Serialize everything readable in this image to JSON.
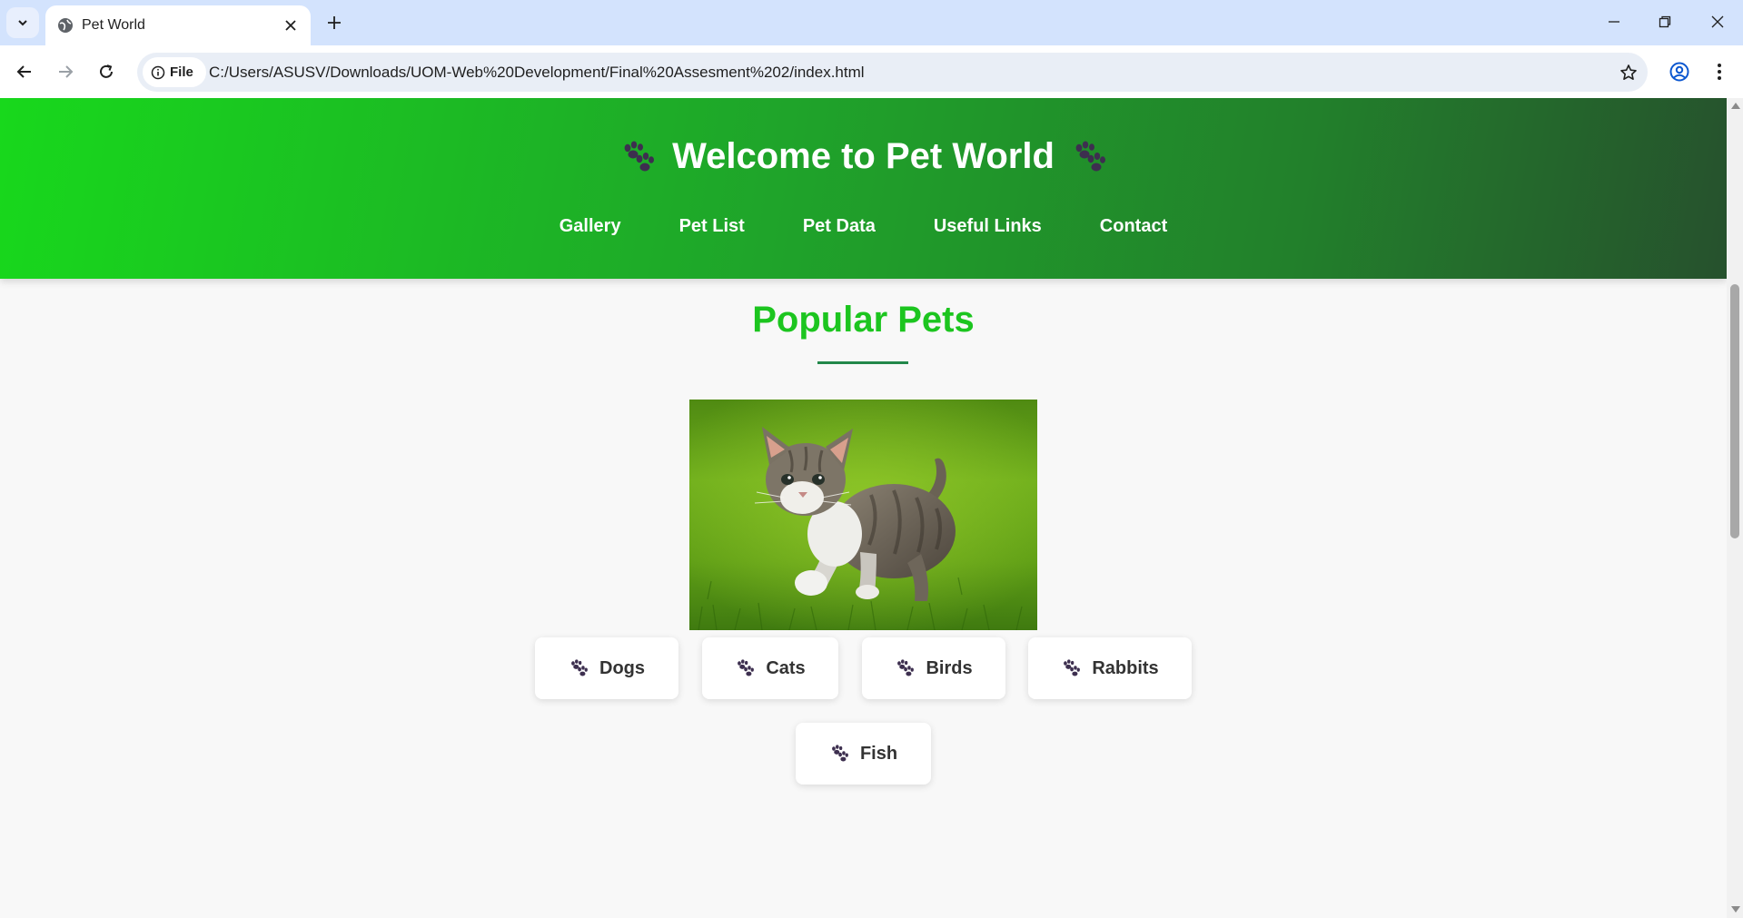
{
  "browser": {
    "tab_title": "Pet World",
    "site_chip_label": "File",
    "url": "C:/Users/ASUSV/Downloads/UOM-Web%20Development/Final%20Assesment%202/index.html"
  },
  "header": {
    "title": "Welcome to Pet World",
    "nav": [
      "Gallery",
      "Pet List",
      "Pet Data",
      "Useful Links",
      "Contact"
    ]
  },
  "section": {
    "title": "Popular Pets"
  },
  "pets": [
    "Dogs",
    "Cats",
    "Birds",
    "Rabbits",
    "Fish"
  ],
  "colors": {
    "header_gradient_start": "#18d81c",
    "header_gradient_end": "#26512d",
    "section_title": "#1cc51f",
    "underline": "#22874a",
    "paw_icon": "#3d2f4f"
  }
}
